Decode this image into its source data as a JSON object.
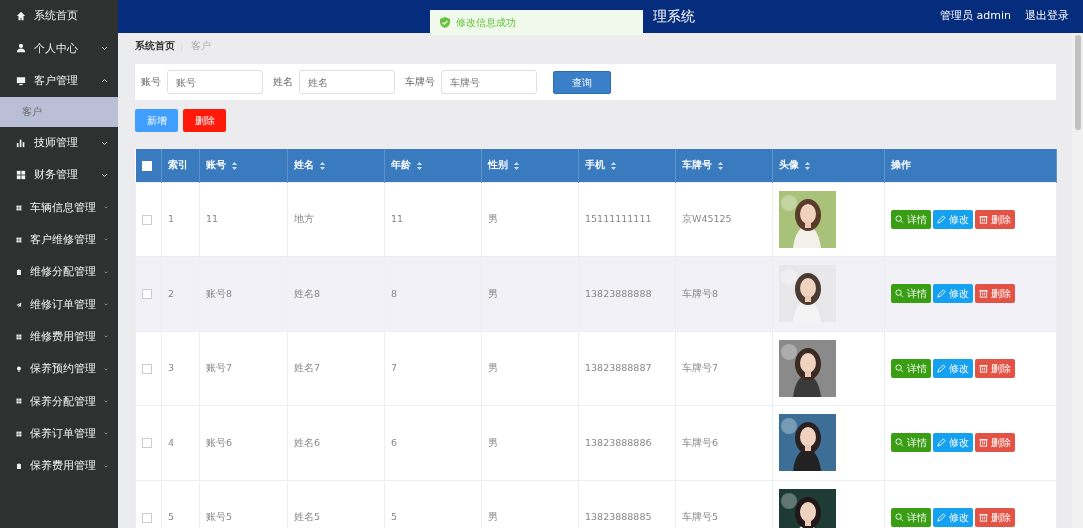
{
  "header": {
    "title": "理系统",
    "user_label": "管理员 admin",
    "logout": "退出登录"
  },
  "toast": {
    "message": "修改信息成功"
  },
  "sidebar": {
    "items": [
      {
        "label": "系统首页"
      },
      {
        "label": "个人中心",
        "expanded": false
      },
      {
        "label": "客户管理",
        "expanded": true,
        "children": [
          {
            "label": "客户",
            "selected": true
          }
        ]
      },
      {
        "label": "技师管理",
        "expanded": false
      },
      {
        "label": "财务管理",
        "expanded": false
      },
      {
        "label": "车辆信息管理",
        "expanded": false
      },
      {
        "label": "客户维修管理",
        "expanded": false
      },
      {
        "label": "维修分配管理",
        "expanded": false
      },
      {
        "label": "维修订单管理",
        "expanded": false
      },
      {
        "label": "维修费用管理",
        "expanded": false
      },
      {
        "label": "保养预约管理",
        "expanded": false
      },
      {
        "label": "保养分配管理",
        "expanded": false
      },
      {
        "label": "保养订单管理",
        "expanded": false
      },
      {
        "label": "保养费用管理",
        "expanded": false
      }
    ]
  },
  "breadcrumb": [
    "系统首页",
    "客户"
  ],
  "search": {
    "fields": [
      {
        "label": "账号",
        "placeholder": "账号"
      },
      {
        "label": "姓名",
        "placeholder": "姓名"
      },
      {
        "label": "车牌号",
        "placeholder": "车牌号"
      }
    ],
    "button": "查询"
  },
  "actions": [
    {
      "label": "新增",
      "kind": "add"
    },
    {
      "label": "删除",
      "kind": "delete"
    }
  ],
  "table": {
    "select_all_checked": false,
    "columns": [
      {
        "label": "索引",
        "sortable": false
      },
      {
        "label": "账号",
        "sortable": true
      },
      {
        "label": "姓名",
        "sortable": true
      },
      {
        "label": "年龄",
        "sortable": true
      },
      {
        "label": "性别",
        "sortable": true
      },
      {
        "label": "手机",
        "sortable": true
      },
      {
        "label": "车牌号",
        "sortable": true
      },
      {
        "label": "头像",
        "sortable": true
      },
      {
        "label": "操作",
        "sortable": false
      }
    ],
    "rows": [
      {
        "checked": false,
        "highlighted": false,
        "cells": [
          "1",
          "11",
          "地方",
          "11",
          "男",
          "15111111111",
          "京W45125"
        ],
        "buttons": [
          {
            "label": "详情",
            "kind": "detail"
          },
          {
            "label": "修改",
            "kind": "edit"
          },
          {
            "label": "删除",
            "kind": "delete"
          }
        ]
      },
      {
        "checked": false,
        "highlighted": true,
        "cells": [
          "2",
          "账号8",
          "姓名8",
          "8",
          "男",
          "13823888888",
          "车牌号8"
        ],
        "buttons": [
          {
            "label": "详情",
            "kind": "detail"
          },
          {
            "label": "修改",
            "kind": "edit"
          },
          {
            "label": "删除",
            "kind": "delete"
          }
        ]
      },
      {
        "checked": false,
        "highlighted": false,
        "cells": [
          "3",
          "账号7",
          "姓名7",
          "7",
          "男",
          "13823888887",
          "车牌号7"
        ],
        "buttons": [
          {
            "label": "详情",
            "kind": "detail"
          },
          {
            "label": "修改",
            "kind": "edit"
          },
          {
            "label": "删除",
            "kind": "delete"
          }
        ]
      },
      {
        "checked": false,
        "highlighted": false,
        "cells": [
          "4",
          "账号6",
          "姓名6",
          "6",
          "男",
          "13823888886",
          "车牌号6"
        ],
        "buttons": [
          {
            "label": "详情",
            "kind": "detail"
          },
          {
            "label": "修改",
            "kind": "edit"
          },
          {
            "label": "删除",
            "kind": "delete"
          }
        ]
      },
      {
        "checked": false,
        "highlighted": false,
        "cells": [
          "5",
          "账号5",
          "姓名5",
          "5",
          "男",
          "13823888885",
          "车牌号5"
        ],
        "buttons": [
          {
            "label": "详情",
            "kind": "detail"
          },
          {
            "label": "修改",
            "kind": "edit"
          },
          {
            "label": "删除",
            "kind": "delete"
          }
        ]
      }
    ]
  }
}
